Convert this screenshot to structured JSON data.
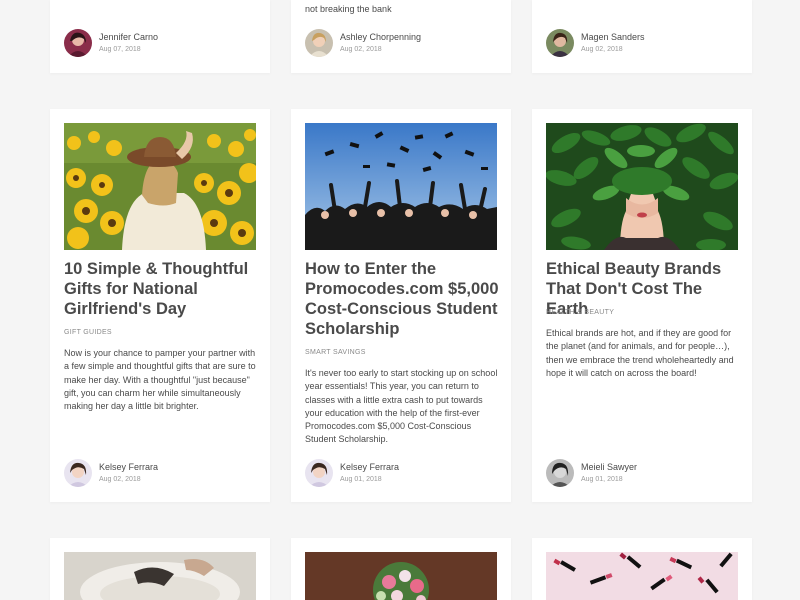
{
  "top_row": [
    {
      "partial_text": "",
      "author": "Jennifer Carno",
      "date": "Aug 07, 2018",
      "avatar_icon": "avatar-icon"
    },
    {
      "partial_text": "not breaking the bank",
      "author": "Ashley Chorpenning",
      "date": "Aug 02, 2018",
      "avatar_icon": "avatar-icon"
    },
    {
      "partial_text": "",
      "author": "Magen Sanders",
      "date": "Aug 02, 2018",
      "avatar_icon": "avatar-icon"
    }
  ],
  "posts": [
    {
      "title": "10 Simple & Thoughtful Gifts for National Girlfriend's Day",
      "category": "Gift Guides",
      "excerpt": "Now is your chance to pamper your partner with a few simple and thoughtful gifts that are sure to make her day. With a thoughtful \"just because\" gift, you can charm her while simultaneously making her day a little bit brighter.",
      "author": "Kelsey Ferrara",
      "date": "Aug 02, 2018",
      "image": "sunflower-field-photo"
    },
    {
      "title": "How to Enter the Promocodes.com $5,000 Cost-Conscious Student Scholarship",
      "category": "Smart Savings",
      "excerpt": "It's never too early to start stocking up on school year essentials! This year, you can return to classes with a little extra cash to put towards your education with the help of the first-ever Promocodes.com $5,000 Cost-Conscious Student Scholarship.",
      "author": "Kelsey Ferrara",
      "date": "Aug 01, 2018",
      "image": "graduation-caps-photo"
    },
    {
      "title": "Ethical Beauty Brands That Don't Cost The Earth",
      "category": "Health & Beauty",
      "excerpt": "Ethical brands are hot, and if they are good for the planet (and for animals, and for people…), then we embrace the trend wholeheartedly and hope it will catch on across the board!",
      "author": "Meieli Sawyer",
      "date": "Aug 01, 2018",
      "image": "leaves-portrait-photo"
    }
  ],
  "bottom_row": [
    {
      "image": "bathtub-photo"
    },
    {
      "image": "flower-bouquet-photo"
    },
    {
      "image": "lipsticks-photo"
    }
  ],
  "colors": {
    "page_bg": "#f5f5f5",
    "card_bg": "#ffffff",
    "title": "#4a4a4a",
    "meta": "#9a9a9a"
  }
}
